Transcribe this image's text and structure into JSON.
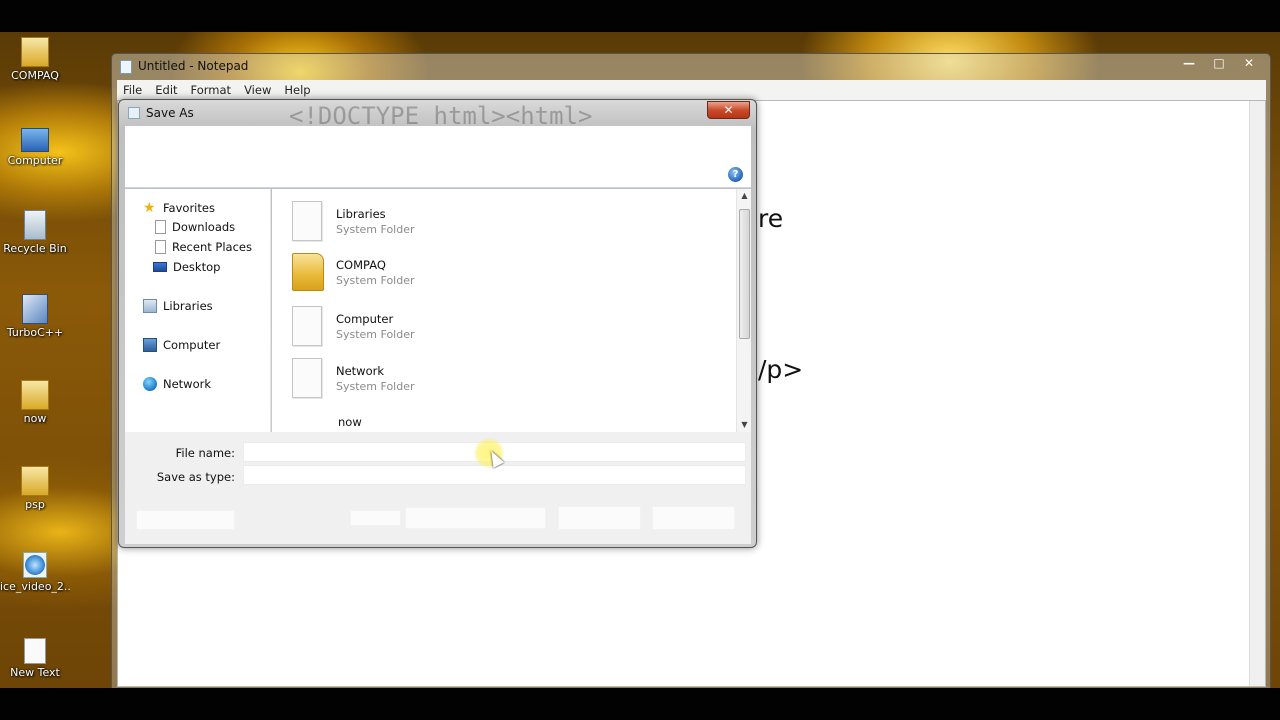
{
  "desktop": {
    "icons": [
      {
        "label": "COMPAQ",
        "icon": "folder-icon"
      },
      {
        "label": "Computer",
        "icon": "computer-icon"
      },
      {
        "label": "Recycle Bin",
        "icon": "recycle-bin-icon"
      },
      {
        "label": "TurboC++",
        "icon": "turboc-shortcut-icon"
      },
      {
        "label": "now",
        "icon": "folder-icon"
      },
      {
        "label": "psp",
        "icon": "folder-icon"
      },
      {
        "label": "ice_video_2...",
        "icon": "video-file-icon"
      },
      {
        "label": "New Text",
        "icon": "text-file-icon"
      }
    ]
  },
  "notepad": {
    "title": "Untitled - Notepad",
    "menu": [
      "File",
      "Edit",
      "Format",
      "View",
      "Help"
    ],
    "window_buttons": {
      "minimize": "—",
      "maximize": "□",
      "close": "✕"
    },
    "text_fragments": [
      "re",
      "/p>"
    ]
  },
  "save_as": {
    "title": "Save As",
    "ghost_text": "<!DOCTYPE html><html>",
    "close": "✕",
    "help": "?",
    "nav": {
      "favorites": "Favorites",
      "downloads": "Downloads",
      "recent_places": "Recent Places",
      "desktop": "Desktop",
      "libraries": "Libraries",
      "computer": "Computer",
      "network": "Network"
    },
    "files": [
      {
        "name": "Libraries",
        "type": "System Folder",
        "icon": "page-icon"
      },
      {
        "name": "COMPAQ",
        "type": "System Folder",
        "icon": "folder-icon"
      },
      {
        "name": "Computer",
        "type": "System Folder",
        "icon": "page-icon"
      },
      {
        "name": "Network",
        "type": "System Folder",
        "icon": "page-icon"
      }
    ],
    "partial_file": "now",
    "file_name_label": "File name:",
    "file_name_value": "",
    "save_as_type_label": "Save as type:",
    "save_as_type_value": ""
  },
  "colors": {
    "selection_blue": "#3b78d0",
    "close_red": "#c94b2b",
    "folder_yellow": "#e8b938"
  }
}
